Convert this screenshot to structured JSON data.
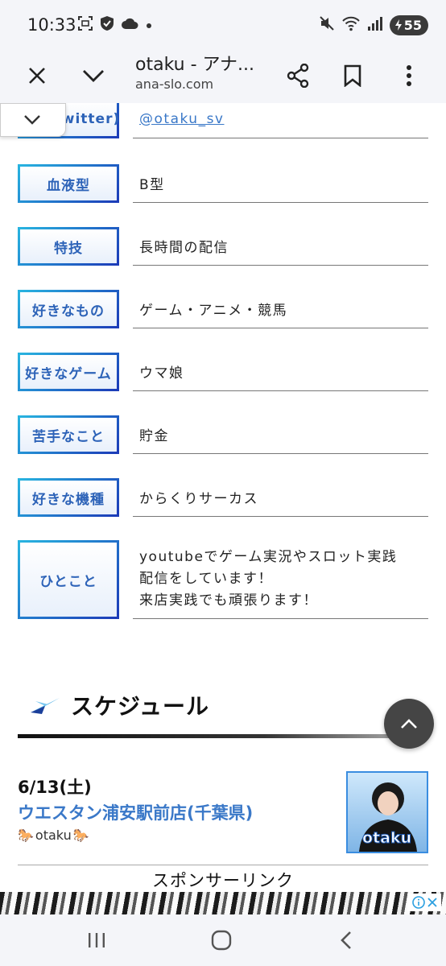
{
  "status_bar": {
    "time": "10:33",
    "battery_level": "55",
    "icons": [
      "screenshot-icon",
      "shield-check-icon",
      "cloud-icon",
      "dot-icon",
      "mute-icon",
      "wifi-icon",
      "signal-icon",
      "battery-icon"
    ]
  },
  "browser": {
    "page_title": "otaku - アナ...",
    "url": "ana-slo.com"
  },
  "profile": {
    "twitter_label_partial": "witter)",
    "twitter_handle": "@otaku_sv",
    "rows": [
      {
        "label": "血液型",
        "value": "B型"
      },
      {
        "label": "特技",
        "value": "長時間の配信"
      },
      {
        "label": "好きなもの",
        "value": "ゲーム・アニメ・競馬"
      },
      {
        "label": "好きなゲーム",
        "value": "ウマ娘"
      },
      {
        "label": "苦手なこと",
        "value": "貯金"
      },
      {
        "label": "好きな機種",
        "value": "からくりサーカス"
      }
    ],
    "message": {
      "label": "ひとこと",
      "lines": [
        "youtubeでゲーム実況やスロット実践",
        "配信をしています！",
        "来店実践でも頑張ります！"
      ]
    }
  },
  "schedule": {
    "heading": "スケジュール",
    "events": [
      {
        "date": "6/13(土)",
        "venue": "ウエスタン浦安駅前店(千葉県)",
        "performer": "otaku",
        "thumbnail_text": "otaku"
      }
    ]
  },
  "sponsor": {
    "label": "スポンサーリンク"
  },
  "colors": {
    "label_text": "#2d63b8",
    "label_border_start": "#28b4e0",
    "label_border_end": "#1c3bb8",
    "venue_link": "#3a78c8",
    "fab_bg": "#454545"
  }
}
